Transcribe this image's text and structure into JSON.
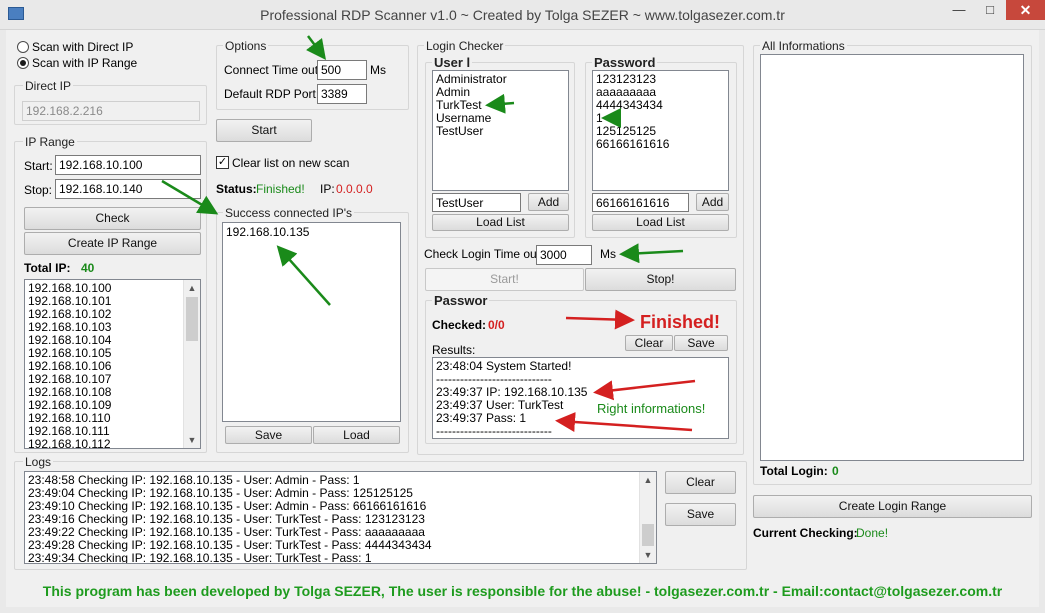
{
  "window": {
    "title": "Professional RDP Scanner v1.0 ~ Created by Tolga SEZER ~ www.tolgasezer.com.tr"
  },
  "scan_mode": {
    "direct_label": "Scan with Direct IP",
    "range_label": "Scan with IP Range",
    "selected": "range"
  },
  "direct_ip": {
    "group_label": "Direct IP",
    "value": "192.168.2.216"
  },
  "ip_range": {
    "group_label": "IP Range",
    "start_label": "Start:",
    "start_value": "192.168.10.100",
    "stop_label": "Stop:",
    "stop_value": "192.168.10.140",
    "check_label": "Check",
    "create_label": "Create IP Range",
    "total_label": "Total IP:",
    "total_value": "40",
    "ips": [
      "192.168.10.100",
      "192.168.10.101",
      "192.168.10.102",
      "192.168.10.103",
      "192.168.10.104",
      "192.168.10.105",
      "192.168.10.106",
      "192.168.10.107",
      "192.168.10.108",
      "192.168.10.109",
      "192.168.10.110",
      "192.168.10.111",
      "192.168.10.112"
    ]
  },
  "options": {
    "group_label": "Options",
    "timeout_label": "Connect Time out:",
    "timeout_value": "500",
    "timeout_unit": "Ms",
    "port_label": "Default RDP Port:",
    "port_value": "3389",
    "start_label": "Start",
    "clear_list_label": "Clear list on new scan",
    "status_label": "Status:",
    "status_value": "Finished!",
    "ip_label": "IP:",
    "ip_value": "0.0.0.0"
  },
  "success": {
    "group_label": "Success connected IP's",
    "items": [
      "192.168.10.135"
    ],
    "save_label": "Save",
    "load_label": "Load"
  },
  "login_checker": {
    "group_label": "Login Checker",
    "user_group": "User l",
    "users": [
      "Administrator",
      "Admin",
      "TurkTest",
      "Username",
      "TestUser"
    ],
    "user_input": "TestUser",
    "password_group": "Password",
    "passwords": [
      "123123123",
      "aaaaaaaaa",
      "4444343434",
      "1",
      "125125125",
      "66166161616"
    ],
    "password_input": "66166161616",
    "add_label": "Add",
    "load_list_label": "Load List",
    "check_timeout_label": "Check Login Time out:",
    "check_timeout_value": "3000",
    "check_timeout_unit": "Ms",
    "start_label": "Start!",
    "stop_label": "Stop!"
  },
  "passwords_panel": {
    "group_label": "Passwor",
    "checked_label": "Checked:",
    "checked_value": "0/0",
    "finished_text": "Finished!",
    "clear_label": "Clear",
    "save_label": "Save",
    "results_label": "Results:",
    "results": [
      "23:48:04 System Started!",
      "-----------------------------",
      "23:49:37 IP: 192.168.10.135",
      "23:49:37 User: TurkTest",
      "23:49:37 Pass: 1",
      "-----------------------------"
    ],
    "annotation": "Right informations!"
  },
  "all_info": {
    "group_label": "All Informations",
    "total_login_label": "Total Login:",
    "total_login_value": "0",
    "create_login_label": "Create Login Range",
    "current_label": "Current Checking:",
    "current_value": "Done!"
  },
  "logs": {
    "group_label": "Logs",
    "lines": [
      "23:48:58 Checking IP: 192.168.10.135 - User: Admin - Pass: 1",
      "23:49:04 Checking IP: 192.168.10.135 - User: Admin - Pass: 125125125",
      "23:49:10 Checking IP: 192.168.10.135 - User: Admin - Pass: 66166161616",
      "23:49:16 Checking IP: 192.168.10.135 - User: TurkTest - Pass: 123123123",
      "23:49:22 Checking IP: 192.168.10.135 - User: TurkTest - Pass: aaaaaaaaa",
      "23:49:28 Checking IP: 192.168.10.135 - User: TurkTest - Pass: 4444343434",
      "23:49:34 Checking IP: 192.168.10.135 - User: TurkTest - Pass: 1"
    ],
    "clear_label": "Clear",
    "save_label": "Save"
  },
  "footer": "This program has been developed by Tolga SEZER, The user is responsible for the abuse! - tolgasezer.com.tr -  Email:contact@tolgasezer.com.tr",
  "colors": {
    "accent_green": "#1a8a1a",
    "accent_red": "#d42020",
    "close_red": "#c7483c"
  }
}
